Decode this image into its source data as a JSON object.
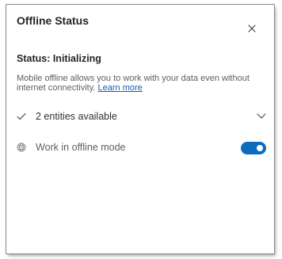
{
  "panel": {
    "title": "Offline Status",
    "close_icon": "close-icon"
  },
  "status": {
    "text": "Status: Initializing"
  },
  "description": {
    "text": "Mobile offline allows you to work with your data even without internet connectivity.",
    "link_label": "Learn more"
  },
  "entities": {
    "icon": "checkmark-icon",
    "label": "2 entities available",
    "expand_icon": "chevron-down-icon"
  },
  "offline_mode": {
    "icon": "globe-icon",
    "label": "Work in offline mode",
    "enabled": true
  },
  "colors": {
    "accent": "#0f6cbd",
    "link": "#0f5dbd",
    "text_primary": "#242424",
    "text_secondary": "#605e5c"
  }
}
